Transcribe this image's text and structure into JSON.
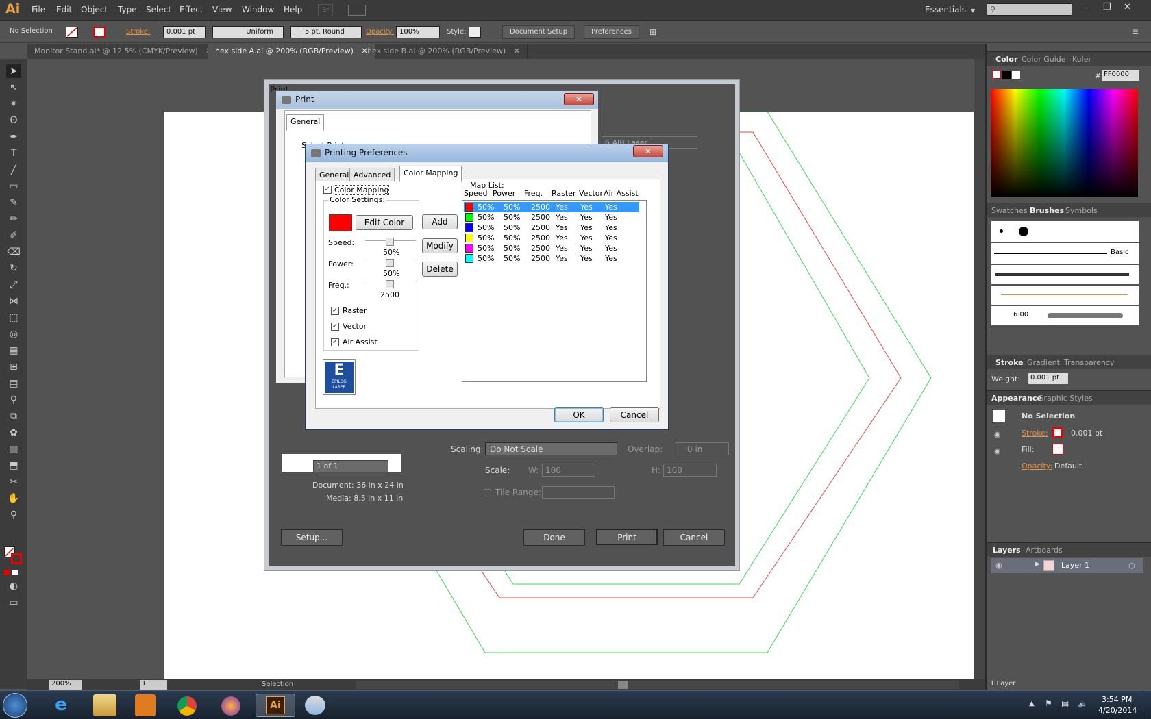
{
  "app": {
    "logo": "Ai",
    "accent": "#e8a33c"
  },
  "menu": [
    "File",
    "Edit",
    "Object",
    "Type",
    "Select",
    "Effect",
    "View",
    "Window",
    "Help"
  ],
  "menubar_right": {
    "workspace": "Essentials",
    "search_placeholder": ""
  },
  "options_bar": {
    "selection": "No Selection",
    "stroke_label": "Stroke:",
    "stroke_weight": "0.001 pt",
    "profile": "Uniform",
    "brush": "5 pt. Round",
    "opacity_label": "Opacity:",
    "opacity": "100%",
    "style_label": "Style:",
    "document_setup": "Document Setup",
    "preferences": "Preferences"
  },
  "doc_tabs": [
    {
      "label": "Monitor Stand.ai* @ 12.5% (CMYK/Preview)",
      "active": false
    },
    {
      "label": "hex side A.ai @ 200% (RGB/Preview)",
      "active": true
    },
    {
      "label": "hex side B.ai @ 200% (RGB/Preview)",
      "active": false
    }
  ],
  "color_panel": {
    "tabs": [
      "Color",
      "Color Guide",
      "Kuler"
    ],
    "hex_label": "#",
    "hex": "FF0000"
  },
  "brushes_panel": {
    "tabs": [
      "Swatches",
      "Brushes",
      "Symbols"
    ],
    "basic_label": "Basic",
    "brush_size": "6.00"
  },
  "stroke_panel": {
    "tabs": [
      "Stroke",
      "Gradient",
      "Transparency"
    ],
    "weight_label": "Weight:",
    "weight": "0.001 pt"
  },
  "appearance_panel": {
    "tabs": [
      "Appearance",
      "Graphic Styles"
    ],
    "title": "No Selection",
    "stroke_label": "Stroke:",
    "stroke_value": "0.001 pt",
    "fill_label": "Fill:",
    "opacity_label": "Opacity:",
    "opacity_value": "Default"
  },
  "layers_panel": {
    "tabs": [
      "Layers",
      "Artboards"
    ],
    "layer_name": "Layer 1",
    "footer": "1 Layer"
  },
  "print_dialog": {
    "title": "Print",
    "page_nav": "1 of 1",
    "document": "Document: 36 in x 24 in",
    "media": "Media: 8.5 in x 11 in",
    "printer_partial": "6 AIB Laser",
    "scaling_label": "Scaling:",
    "scaling": "Do Not Scale",
    "overlap_label": "Overlap:",
    "overlap": "0 in",
    "scale_label": "Scale:",
    "w_label": "W:",
    "w": "100",
    "h_label": "H:",
    "h": "100",
    "tile_range": "Tile Range:",
    "setup": "Setup...",
    "done": "Done",
    "print": "Print",
    "cancel": "Cancel"
  },
  "win_print": {
    "title": "Print",
    "tab": "General",
    "select_printer": "Select Printer"
  },
  "prefs": {
    "title": "Printing Preferences",
    "tabs": [
      "General",
      "Advanced",
      "Color Mapping"
    ],
    "color_mapping_label": "Color Mapping",
    "color_settings": "Color Settings:",
    "edit_color": "Edit Color",
    "add": "Add",
    "modify": "Modify",
    "delete": "Delete",
    "speed_label": "Speed:",
    "speed": "50%",
    "power_label": "Power:",
    "power": "50%",
    "freq_label": "Freq.:",
    "freq": "2500",
    "raster": "Raster",
    "vector": "Vector",
    "air_assist": "Air Assist",
    "logo_letter": "E",
    "logo_text1": "EPILOG",
    "logo_text2": "LASER",
    "map_list": "Map List:",
    "columns": [
      "Speed",
      "Power",
      "Freq.",
      "Raster",
      "Vector",
      "Air Assist"
    ],
    "rows": [
      {
        "color": "#ff0000",
        "speed": "50%",
        "power": "50%",
        "freq": "2500",
        "raster": "Yes",
        "vector": "Yes",
        "air": "Yes",
        "selected": true
      },
      {
        "color": "#00ff00",
        "speed": "50%",
        "power": "50%",
        "freq": "2500",
        "raster": "Yes",
        "vector": "Yes",
        "air": "Yes"
      },
      {
        "color": "#0000ff",
        "speed": "50%",
        "power": "50%",
        "freq": "2500",
        "raster": "Yes",
        "vector": "Yes",
        "air": "Yes"
      },
      {
        "color": "#ffff00",
        "speed": "50%",
        "power": "50%",
        "freq": "2500",
        "raster": "Yes",
        "vector": "Yes",
        "air": "Yes"
      },
      {
        "color": "#ff00ff",
        "speed": "50%",
        "power": "50%",
        "freq": "2500",
        "raster": "Yes",
        "vector": "Yes",
        "air": "Yes"
      },
      {
        "color": "#00ffff",
        "speed": "50%",
        "power": "50%",
        "freq": "2500",
        "raster": "Yes",
        "vector": "Yes",
        "air": "Yes"
      }
    ],
    "ok": "OK",
    "cancel": "Cancel"
  },
  "status": {
    "zoom": "200%",
    "artboard": "1",
    "tool": "Selection"
  },
  "taskbar": {
    "time": "3:54 PM",
    "date": "4/20/2014"
  }
}
